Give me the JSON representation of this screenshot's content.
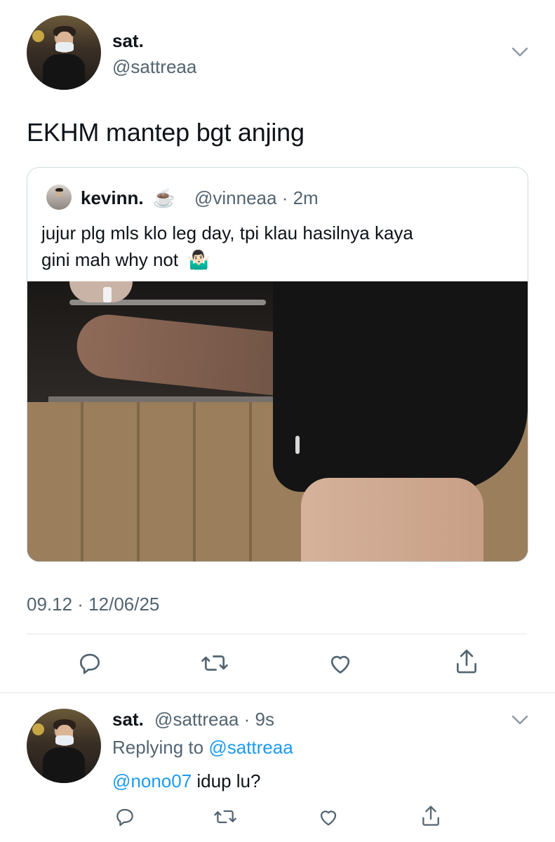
{
  "tweet": {
    "author_name": "sat.",
    "author_handle": "@sattreaa",
    "text": "EKHM mantep bgt anjing",
    "timestamp": "09.12 · 12/06/25"
  },
  "quote": {
    "author_name": "kevinn.",
    "author_emoji": "☕",
    "author_handle": "@vinneaa",
    "time": "· 2m",
    "text_line1": "jujur plg mls klo leg day, tpi klau hasilnya kaya",
    "text_line2": "gini mah why not",
    "emoji": "🤷🏻‍♂️"
  },
  "actions": {
    "icons": [
      "reply-icon",
      "retweet-icon",
      "like-icon",
      "share-icon"
    ]
  },
  "reply": {
    "author_name": "sat.",
    "author_handle": "@sattreaa",
    "time": "· 9s",
    "replying_prefix": "Replying to",
    "replying_handle": "@sattreaa",
    "mention": "@nono07",
    "text": " idup lu?"
  },
  "colors": {
    "accent": "#1d9bf0",
    "secondary_text": "#536471",
    "border": "#cfd9de"
  }
}
